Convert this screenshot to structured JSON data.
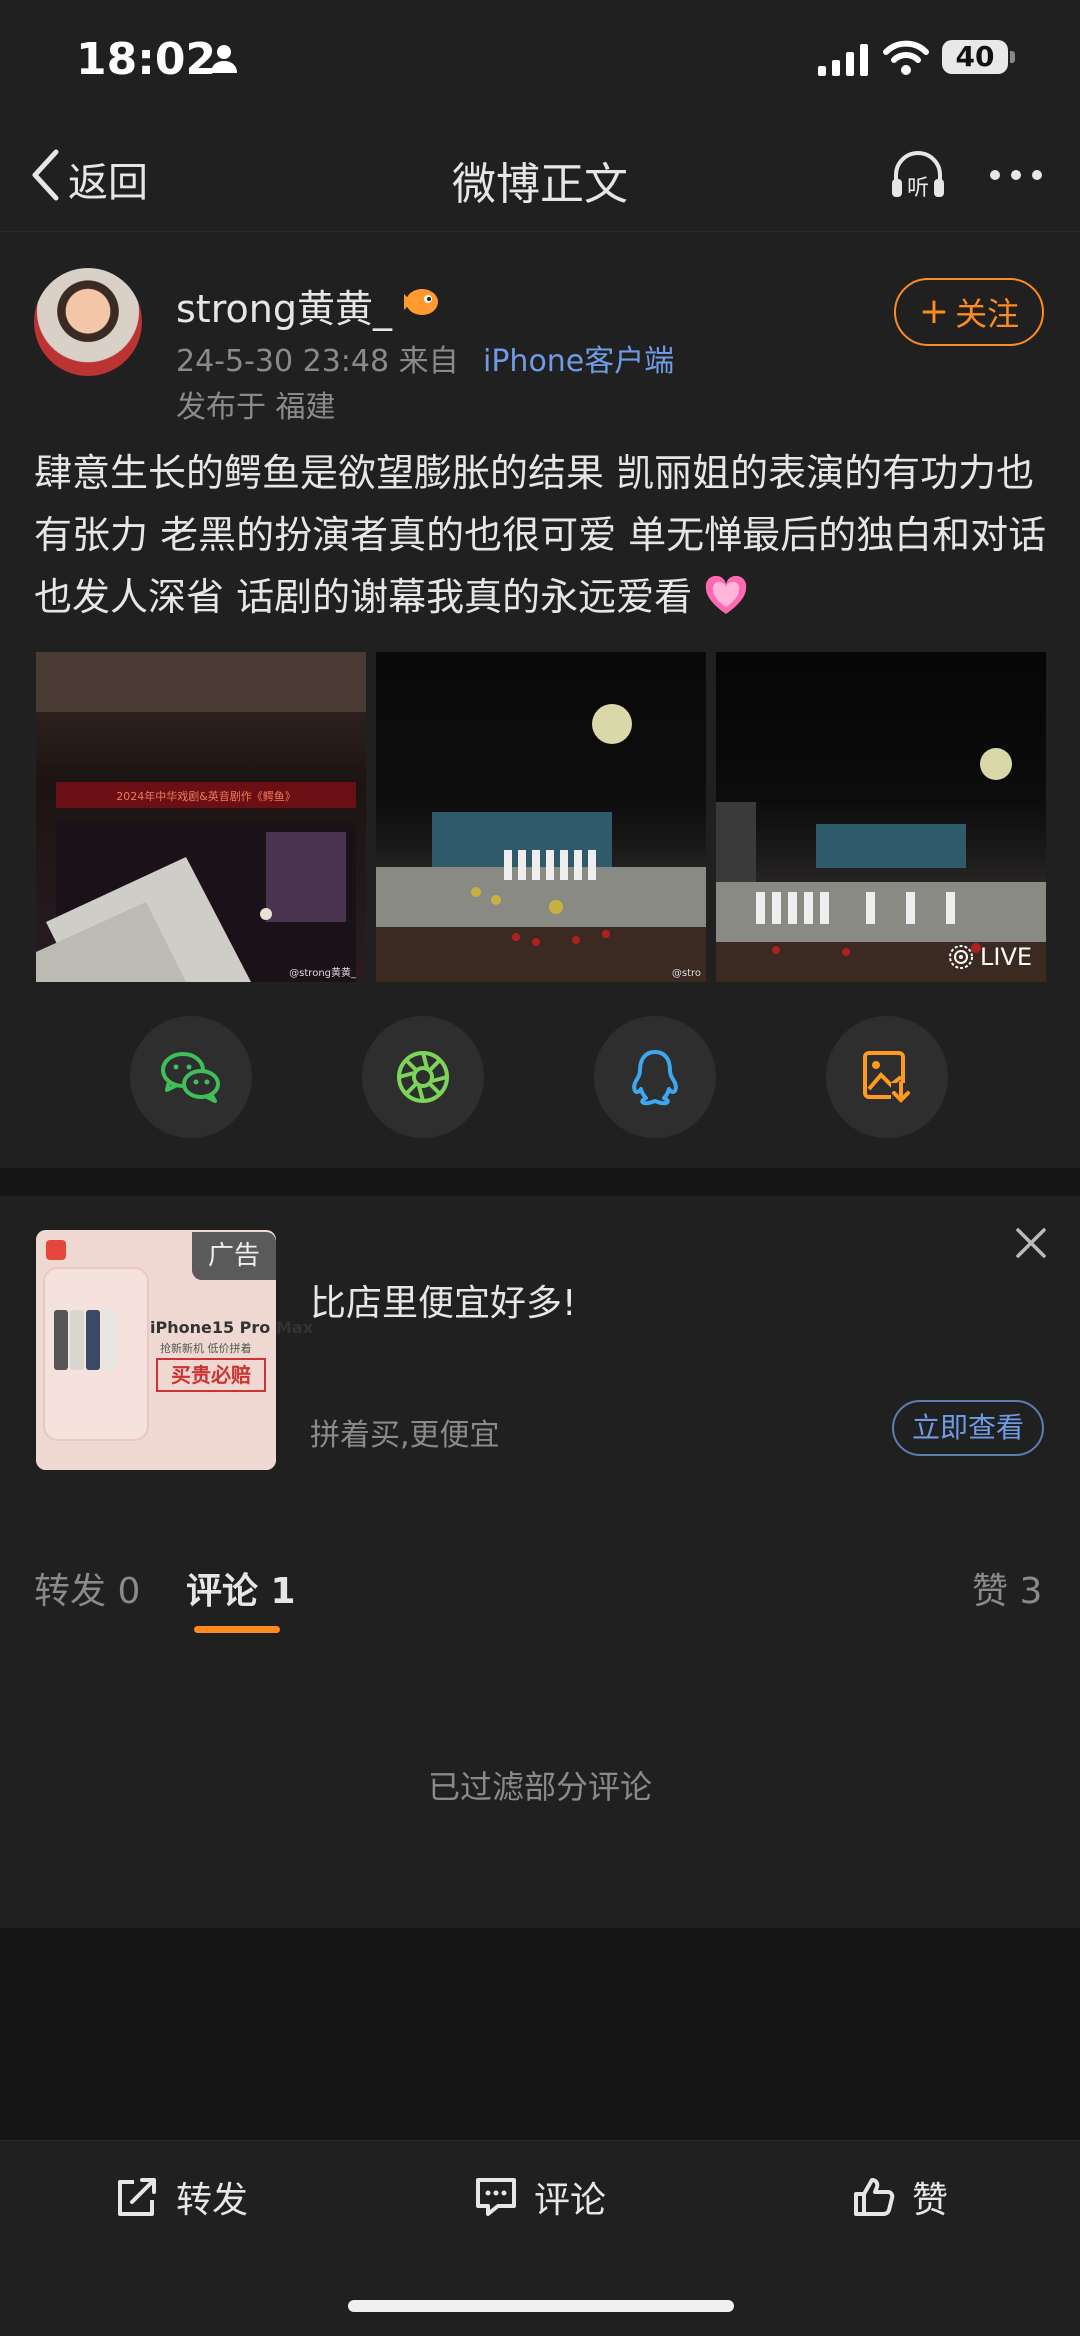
{
  "status_bar": {
    "time": "18:02",
    "battery": "40"
  },
  "nav": {
    "back_label": "返回",
    "title": "微博正文",
    "listen_label": "听"
  },
  "post": {
    "username": "strong黄黄_",
    "time": "24-5-30 23:48",
    "source_prefix": "来自",
    "source": "iPhone客户端",
    "location": "发布于 福建",
    "follow_label": "关注",
    "text": "肆意生长的鳄鱼是欲望膨胀的结果 凯丽姐的表演的有功力也有张力 老黑的扮演者真的也很可爱 单无惮最后的独白和对话也发人深省 话剧的谢幕我真的永远爱看",
    "photo1_watermark": "@strong黄黄_",
    "photo2_watermark": "@stro",
    "photo3_badge": "LIVE",
    "banner_text": "2024年中华戏剧&英音剧作《鳄鱼》"
  },
  "share": [
    {
      "icon": "wechat-icon"
    },
    {
      "icon": "moments-icon"
    },
    {
      "icon": "qq-icon"
    },
    {
      "icon": "save-image-icon"
    }
  ],
  "ad": {
    "tag": "广告",
    "title": "比店里便宜好多!",
    "subtitle": "拼着买,更便宜",
    "button": "立即查看",
    "product_name": "iPhone15 Pro Max",
    "product_sub": "抢新新机 低价拼着",
    "stamp": "买贵必赔"
  },
  "tabs": {
    "repost": "转发 0",
    "comment": "评论 1",
    "like": "赞 3"
  },
  "filter_note": "已过滤部分评论",
  "toolbar": {
    "repost": "转发",
    "comment": "评论",
    "like": "赞"
  },
  "colors": {
    "accent": "#ff8a1f",
    "link": "#6f9be6",
    "background": "#151515",
    "card": "#202020"
  }
}
